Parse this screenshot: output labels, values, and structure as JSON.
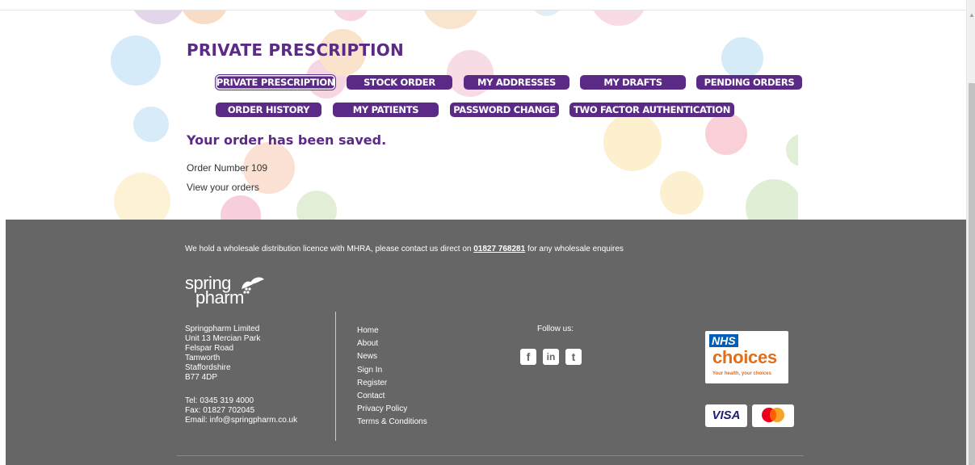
{
  "page": {
    "title": "PRIVATE PRESCRIPTION",
    "saved_message": "Your order has been saved.",
    "order_number_label": "Order Number 109",
    "view_orders_link": "View your orders"
  },
  "nav": {
    "buttons": [
      {
        "label": "PRIVATE PRESCRIPTION",
        "active": true
      },
      {
        "label": "STOCK ORDER"
      },
      {
        "label": "MY ADDRESSES"
      },
      {
        "label": "MY DRAFTS"
      },
      {
        "label": "PENDING ORDERS"
      },
      {
        "label": "ORDER HISTORY"
      },
      {
        "label": "MY PATIENTS"
      },
      {
        "label": "PASSWORD CHANGE"
      },
      {
        "label": "TWO FACTOR AUTHENTICATION"
      }
    ]
  },
  "footer": {
    "licence_prefix": "We hold a wholesale distribution licence with MHRA, please contact us direct on ",
    "licence_phone": "01827 768281",
    "licence_suffix": " for any wholesale enquires",
    "logo_line1": "spring",
    "logo_line2": "pharm",
    "address": [
      "Springpharm Limited",
      "Unit 13 Mercian Park",
      "Felspar Road",
      "Tamworth",
      "Staffordshire",
      "B77 4DP"
    ],
    "tel": "Tel: 0345 319 4000",
    "fax": "Fax: 01827 702045",
    "email": "Email: info@springpharm.co.uk",
    "links": [
      "Home",
      "About",
      "News",
      "Sign In",
      "Register",
      "Contact",
      "Privacy Policy",
      "Terms & Conditions"
    ],
    "follow_label": "Follow us:",
    "social": [
      {
        "icon": "facebook-icon",
        "glyph": "f"
      },
      {
        "icon": "linkedin-icon",
        "glyph": "in"
      },
      {
        "icon": "twitter-icon",
        "glyph": "t"
      }
    ],
    "nhs_tag": "NHS",
    "nhs_choices": "choices",
    "nhs_tagline": "Your health, your choices",
    "visa_label": "VISA"
  },
  "colors": {
    "brand_purple": "#5b2a86",
    "footer_bg": "#666666",
    "nhs_blue": "#005eb8",
    "nhs_orange": "#e36d16"
  }
}
